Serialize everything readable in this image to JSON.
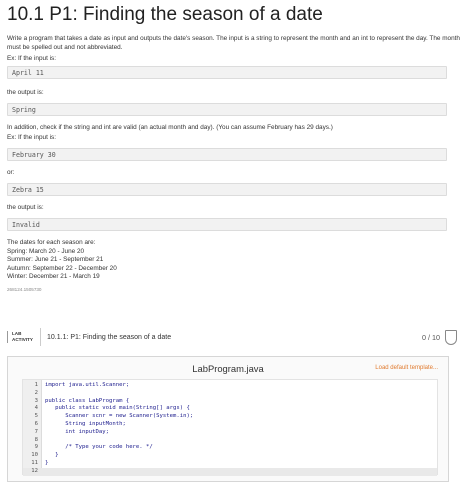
{
  "title": "10.1 P1: Finding the season of a date",
  "intro": "Write a program that takes a date as input and outputs the date's season. The input is a string to represent the month and an int to represent the day. The month must be spelled out and not abbreviated.",
  "ex1_label": "Ex: If the input is:",
  "ex1_input": "April 11",
  "output_label_1": "the output is:",
  "ex1_output": "Spring",
  "validity_text": "In addition, check if the string and int are valid (an actual month and day). (You can assume February has 29 days.)",
  "ex2_label": "Ex: If the input is:",
  "ex2_input": "February 30",
  "or_label": "or:",
  "ex3_input": "Zebra 15",
  "output_label_2": "the output is:",
  "ex2_output": "Invalid",
  "seasons_heading": "The dates for each season are:",
  "seasons": [
    "Spring: March 20 - June 20",
    "Summer: June 21 - September 21",
    "Autumn: September 22 - December 20",
    "Winter: December 21 - March 19"
  ],
  "reference_id": "268124.1505730",
  "lab": {
    "badge_line1": "LAB",
    "badge_line2": "ACTIVITY",
    "title": "10.1.1: P1: Finding the season of a date",
    "score": "0 / 10"
  },
  "editor": {
    "file_name": "LabProgram.java",
    "load_template": "Load default template...",
    "lines": [
      {
        "n": "1",
        "code": "import java.util.Scanner;"
      },
      {
        "n": "2",
        "code": ""
      },
      {
        "n": "3",
        "code": "public class LabProgram {"
      },
      {
        "n": "4",
        "code": "   public static void main(String[] args) {"
      },
      {
        "n": "5",
        "code": "      Scanner scnr = new Scanner(System.in);"
      },
      {
        "n": "6",
        "code": "      String inputMonth;"
      },
      {
        "n": "7",
        "code": "      int inputDay;"
      },
      {
        "n": "8",
        "code": ""
      },
      {
        "n": "9",
        "code": "      /* Type your code here. */"
      },
      {
        "n": "10",
        "code": "   }"
      },
      {
        "n": "11",
        "code": "}"
      },
      {
        "n": "12",
        "code": ""
      }
    ]
  }
}
